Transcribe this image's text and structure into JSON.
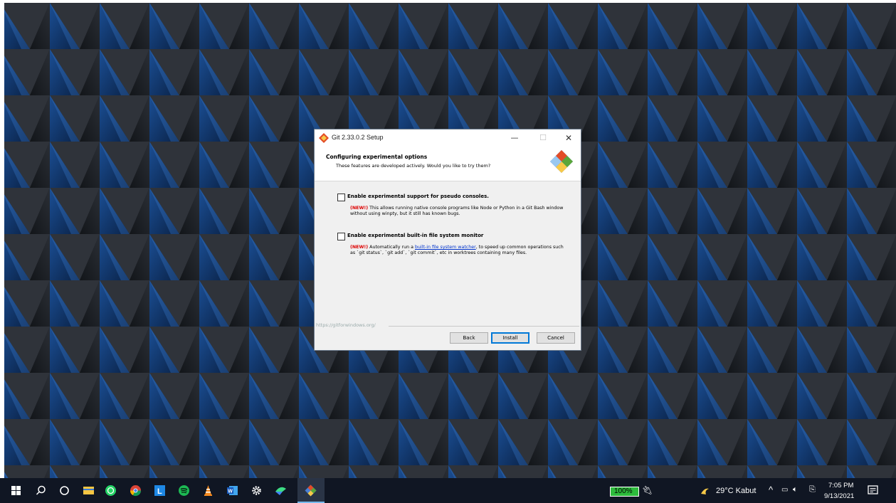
{
  "dialog": {
    "title": "Git 2.33.0.2 Setup",
    "header_title": "Configuring experimental options",
    "header_subtitle": "These features are developed actively. Would you like to try them?",
    "options": [
      {
        "label": "Enable experimental support for pseudo consoles.",
        "new_tag": "(NEW!)",
        "desc": " This allows running native console programs like Node or Python in a Git Bash window without using winpty, but it still has known bugs.",
        "checked": false
      },
      {
        "label": "Enable experimental built-in file system monitor",
        "new_tag": "(NEW!)",
        "desc_before": " Automatically run a ",
        "link_text": "built-in file system watcher",
        "desc_after": ", to speed up common operations such as `git status`, `git add`, `git commit`, etc in worktrees containing many files.",
        "checked": false
      }
    ],
    "footer_url": "https://gitforwindows.org/",
    "buttons": {
      "back": "Back",
      "install": "Install",
      "cancel": "Cancel"
    }
  },
  "taskbar": {
    "battery": "100%",
    "weather": "29°C Kabut",
    "time": "7:05 PM",
    "date": "9/13/2021"
  },
  "colors": {
    "accent": "#0078d7",
    "new_tag": "#dd0000",
    "link": "#0033cc"
  }
}
